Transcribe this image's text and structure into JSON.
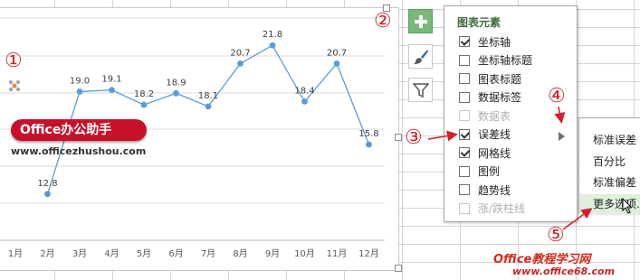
{
  "chart_data": {
    "type": "line",
    "categories": [
      "1月",
      "2月",
      "3月",
      "4月",
      "5月",
      "6月",
      "7月",
      "8月",
      "9月",
      "10月",
      "11月",
      "12月"
    ],
    "series": [
      {
        "values": [
          null,
          12.8,
          19.0,
          19.1,
          18.2,
          18.9,
          18.1,
          20.7,
          21.8,
          18.4,
          20.7,
          15.8
        ]
      }
    ],
    "data_labels": [
      "",
      "12.8",
      "19.0",
      "19.1",
      "18.2",
      "18.9",
      "18.1",
      "20.7",
      "21.8",
      "18.4",
      "20.7",
      "15.8"
    ],
    "ylim": [
      10,
      24
    ],
    "grid": true,
    "line_color": "#5b9bd5"
  },
  "side_buttons": {
    "elements_icon": "plus-icon",
    "styles_icon": "brush-icon",
    "filters_icon": "funnel-icon"
  },
  "panel": {
    "title": "图表元素",
    "items": [
      {
        "label": "坐标轴",
        "checked": true,
        "disabled": false
      },
      {
        "label": "坐标轴标题",
        "checked": false,
        "disabled": false
      },
      {
        "label": "图表标题",
        "checked": false,
        "disabled": false
      },
      {
        "label": "数据标签",
        "checked": false,
        "disabled": false
      },
      {
        "label": "数据表",
        "checked": false,
        "disabled": true
      },
      {
        "label": "误差线",
        "checked": true,
        "disabled": false
      },
      {
        "label": "网格线",
        "checked": true,
        "disabled": false
      },
      {
        "label": "图例",
        "checked": false,
        "disabled": false
      },
      {
        "label": "趋势线",
        "checked": false,
        "disabled": false
      },
      {
        "label": "涨/跌柱线",
        "checked": false,
        "disabled": true
      }
    ]
  },
  "submenu": {
    "items": [
      "标准误差",
      "百分比",
      "标准偏差",
      "更多选项..."
    ]
  },
  "markers": [
    "①",
    "②",
    "③",
    "④",
    "⑤"
  ],
  "branding": {
    "box_text": "Office办公助手",
    "url": "www.officezhushou.com",
    "watermark": "Office教程学习网",
    "watermark_url": "www.office68.com"
  },
  "colors": {
    "accent_green": "#7ab87c",
    "marker_red": "#d51f2a",
    "brand_red": "#c9102a"
  }
}
